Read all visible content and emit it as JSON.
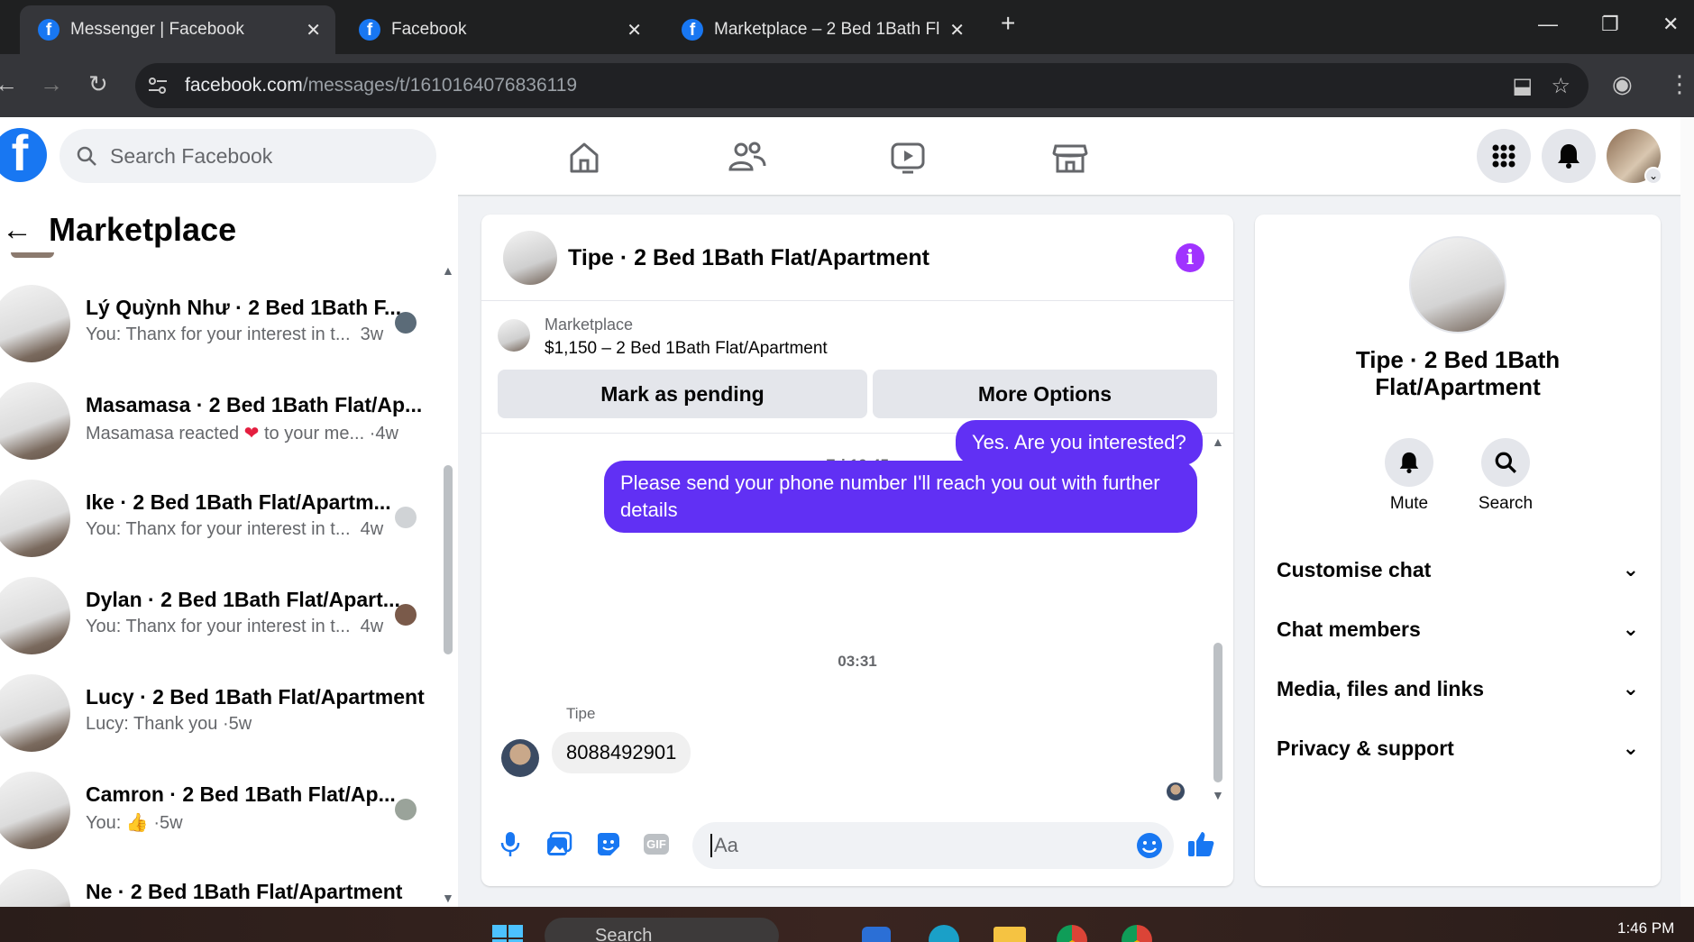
{
  "browser": {
    "tabs": [
      {
        "title": "Messenger | Facebook",
        "active": true
      },
      {
        "title": "Facebook",
        "active": false
      },
      {
        "title": "Marketplace – 2 Bed 1Bath Flat/",
        "active": false
      }
    ],
    "url_domain": "facebook.com",
    "url_path": "/messages/t/1610164076836119"
  },
  "fb_header": {
    "search_placeholder": "Search Facebook"
  },
  "left_panel": {
    "title": "Marketplace",
    "conversations": [
      {
        "name": "Lý Quỳnh Như · 2 Bed 1Bath F...",
        "snippet": "You: Thanx for your interest in t...",
        "time": "3w"
      },
      {
        "name": "Masamasa · 2 Bed 1Bath Flat/Ap...",
        "snippet": "Masamasa reacted",
        "snippet2": "to your me...",
        "time": "·4w"
      },
      {
        "name": "Ike · 2 Bed 1Bath Flat/Apartm...",
        "snippet": "You: Thanx for your interest in t...",
        "time": "4w"
      },
      {
        "name": "Dylan · 2 Bed 1Bath Flat/Apart...",
        "snippet": "You: Thanx for your interest in t...",
        "time": "4w"
      },
      {
        "name": "Lucy · 2 Bed 1Bath Flat/Apartment",
        "snippet": "Lucy: Thank you",
        "time": "·5w"
      },
      {
        "name": "Camron · 2 Bed 1Bath Flat/Ap...",
        "snippet": "You:",
        "time": "·5w"
      },
      {
        "name": "Ne · 2 Bed 1Bath Flat/Apartment",
        "snippet": "",
        "time": ""
      }
    ]
  },
  "chat": {
    "title": "Tipe · 2 Bed 1Bath Flat/Apartment",
    "marketplace_label": "Marketplace",
    "listing": "$1,150 – 2 Bed 1Bath Flat/Apartment",
    "mark_pending": "Mark as pending",
    "more_options": "More Options",
    "ts1": "Fri 16:45",
    "msg_out_1": "Yes. Are you interested?",
    "msg_out_2": "Please send your phone number  I'll reach you out with further details",
    "ts2": "03:31",
    "sender": "Tipe",
    "msg_in_1": "8088492901",
    "composer_placeholder": "Aa"
  },
  "right_panel": {
    "title": "Tipe · 2 Bed 1Bath Flat/Apartment",
    "mute": "Mute",
    "search": "Search",
    "rows": [
      "Customise chat",
      "Chat members",
      "Media, files and links",
      "Privacy & support"
    ]
  },
  "taskbar": {
    "search": "Search",
    "time": "1:46 PM"
  },
  "colors": {
    "fb_blue": "#1877f2",
    "outgoing_bubble": "#6130f4",
    "info_purple": "#a033ff"
  }
}
